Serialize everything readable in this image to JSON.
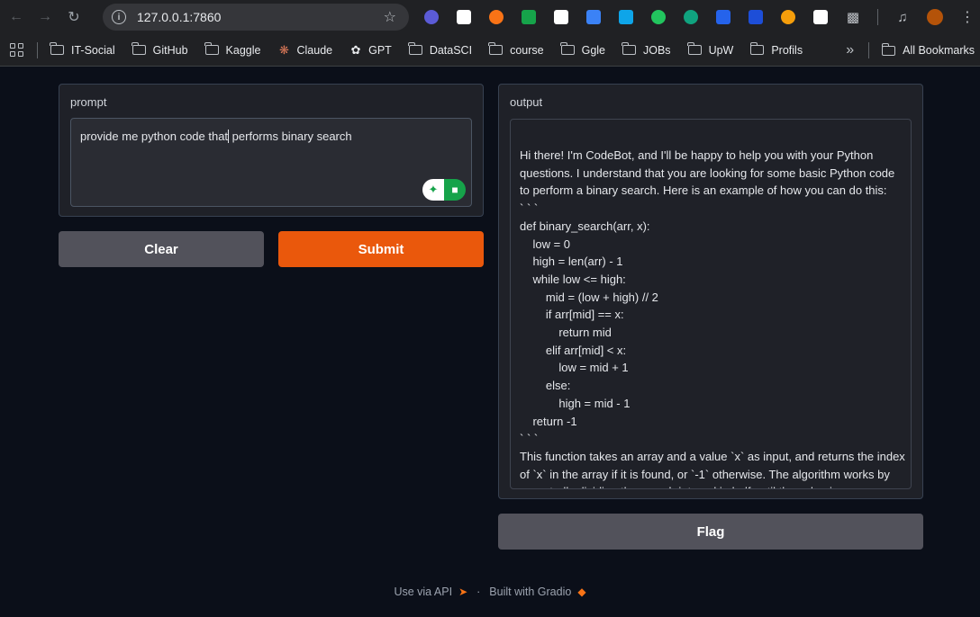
{
  "browser": {
    "url": "127.0.0.1:7860",
    "extensions": [
      {
        "name": "extension-1",
        "color": "#5b5bd6"
      },
      {
        "name": "extension-2",
        "color": "#ffffff"
      },
      {
        "name": "extension-3",
        "color": "#f97316"
      },
      {
        "name": "extension-4",
        "color": "#16a34a"
      },
      {
        "name": "extension-5",
        "color": "#ffffff"
      },
      {
        "name": "extension-6",
        "color": "#3b82f6"
      },
      {
        "name": "extension-7",
        "color": "#0ea5e9"
      },
      {
        "name": "extension-8",
        "color": "#22c55e"
      },
      {
        "name": "extension-9",
        "color": "#10a37f"
      },
      {
        "name": "extension-10",
        "color": "#2563eb"
      },
      {
        "name": "extension-11",
        "color": "#1d4ed8"
      },
      {
        "name": "extension-12",
        "color": "#f59e0b"
      },
      {
        "name": "extension-13",
        "color": "#ffffff"
      }
    ]
  },
  "bookmarks": {
    "items": [
      "IT-Social",
      "GitHub",
      "Kaggle",
      "Claude",
      "GPT",
      "DataSCI",
      "course",
      "Ggle",
      "JOBs",
      "UpW",
      "Profils"
    ],
    "all_label": "All Bookmarks"
  },
  "prompt": {
    "label": "prompt",
    "text_before_caret": "provide me python code that",
    "text_after_caret": " performs binary search"
  },
  "buttons": {
    "clear": "Clear",
    "submit": "Submit",
    "flag": "Flag"
  },
  "output": {
    "label": "output",
    "text": "Hi there! I'm CodeBot, and I'll be happy to help you with your Python questions. I understand that you are looking for some basic Python code to perform a binary search. Here is an example of how you can do this:\n` ` `\ndef binary_search(arr, x):\n    low = 0\n    high = len(arr) - 1\n    while low <= high:\n        mid = (low + high) // 2\n        if arr[mid] == x:\n            return mid\n        elif arr[mid] < x:\n            low = mid + 1\n        else:\n            high = mid - 1\n    return -1\n` ` `\nThis function takes an array and a value `x` as input, and returns the index of `x` in the array if it is found, or `-1` otherwise. The algorithm works by repeatedly dividing the search interval in half until the value is"
  },
  "footer": {
    "api": "Use via API",
    "separator": "·",
    "built": "Built with Gradio"
  }
}
